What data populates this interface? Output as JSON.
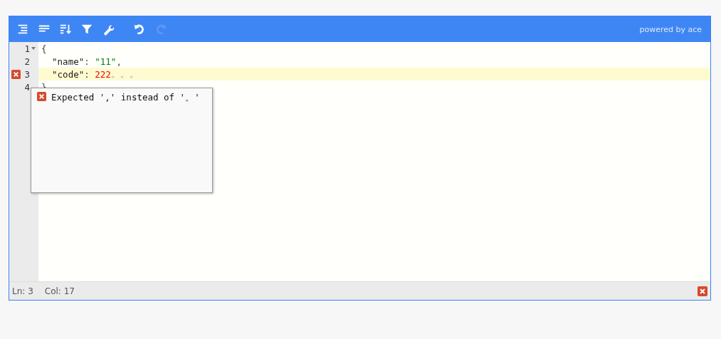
{
  "toolbar": {
    "buttons": [
      {
        "kind": "format",
        "disabled": false
      },
      {
        "kind": "compact",
        "disabled": false
      },
      {
        "kind": "sort",
        "disabled": false
      },
      {
        "kind": "filter",
        "disabled": false
      },
      {
        "kind": "repair",
        "disabled": false
      },
      {
        "kind": "undo",
        "disabled": false
      },
      {
        "kind": "redo",
        "disabled": true
      }
    ],
    "credit": "powered by ace"
  },
  "editor": {
    "lines": [
      {
        "number": "1",
        "fold": true,
        "active": false,
        "tokens": [
          {
            "kind": "punct",
            "text": "{"
          }
        ]
      },
      {
        "number": "2",
        "active": false,
        "tokens": [
          {
            "kind": "key",
            "text": "  \"name\""
          },
          {
            "kind": "punct",
            "text": ": "
          },
          {
            "kind": "string",
            "text": "\"11\""
          },
          {
            "kind": "punct",
            "text": ","
          }
        ]
      },
      {
        "number": "3",
        "error": true,
        "active": true,
        "tokens": [
          {
            "kind": "key",
            "text": "  \"code\""
          },
          {
            "kind": "punct",
            "text": ": "
          },
          {
            "kind": "number",
            "text": "222"
          },
          {
            "kind": "invalid",
            "text": "。。。"
          }
        ]
      },
      {
        "number": "4",
        "active": false,
        "tokens": [
          {
            "kind": "punct",
            "text": "}"
          }
        ]
      }
    ],
    "tooltip": {
      "message": "Expected ',' instead of '。'"
    }
  },
  "status_bar": {
    "line": "Ln: 3",
    "column": "Col: 17",
    "has_error": true
  }
}
